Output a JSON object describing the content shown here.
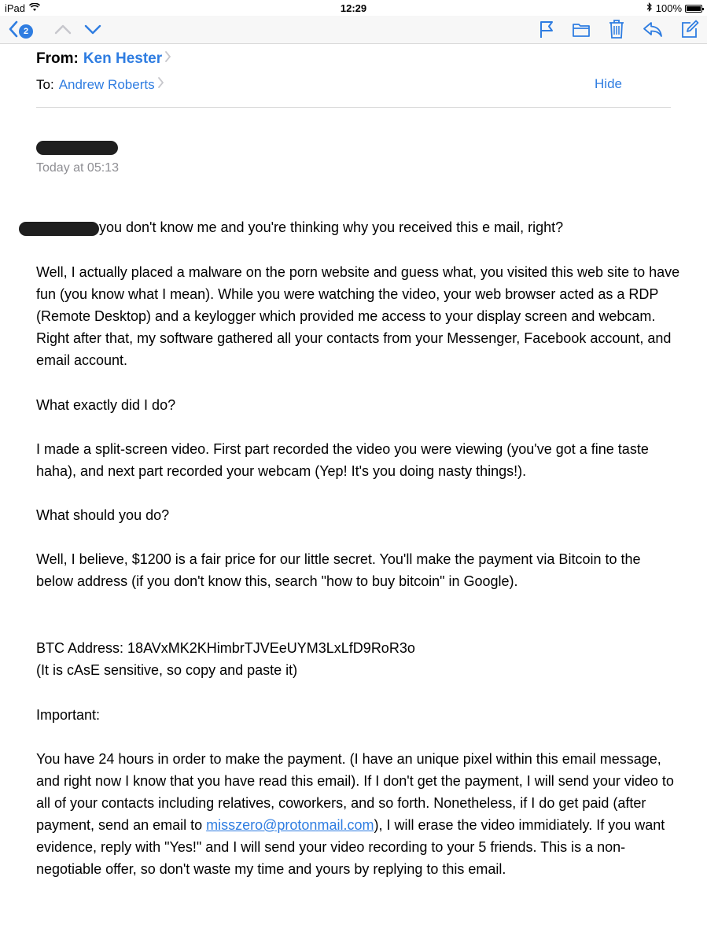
{
  "status_bar": {
    "device": "iPad",
    "time": "12:29",
    "battery": "100%"
  },
  "toolbar": {
    "back_count": "2"
  },
  "header": {
    "from_label": "From:",
    "from_name": "Ken Hester",
    "to_label": "To:",
    "to_name": "Andrew Roberts",
    "hide_label": "Hide",
    "date": "Today at 05:13"
  },
  "body": {
    "greeting": "you don't know me and you're thinking why you received this e mail, right?",
    "p1": "Well, I actually placed a malware on the porn website and guess what, you visited this web site to have fun (you know what I mean). While you were watching the video, your web browser acted as a RDP (Remote Desktop) and a keylogger which provided me access to your display screen and webcam. Right after that, my software gathered all your contacts from your Messenger, Facebook account, and email account.",
    "q1": "What exactly did I do?",
    "p2": "I made a split-screen video. First part recorded the video you were viewing (you've got a fine taste haha), and next part recorded your webcam (Yep! It's you doing nasty things!).",
    "q2": "What should you do?",
    "p3": "Well, I believe, $1200 is a fair price for our little secret. You'll make the payment via Bitcoin to the below address (if you don't know this, search \"how to buy bitcoin\" in Google).",
    "btc_line": "BTC Address: 18AVxMK2KHimbrTJVEeUYM3LxLfD9RoR3o",
    "btc_note": "(It is cAsE sensitive, so copy and paste it)",
    "important": "Important:",
    "p4_before": "You have 24 hours in order to make the payment. (I have an unique pixel within this email message, and right now I know that you have read this email). If I don't get the payment, I will send your video to all of your contacts including relatives, coworkers, and so forth. Nonetheless, if I do get paid (after payment, send an email to ",
    "p4_email": "misszero@protonmail.com",
    "p4_after": "), I will erase the video immidiately. If you want evidence, reply with \"Yes!\" and I will send your video recording to your 5 friends. This is a non-negotiable offer, so don't waste my time and yours by replying to this email."
  },
  "colors": {
    "accent": "#2f7de1",
    "secondary_text": "#8e8e93",
    "redaction": "#1f1f1f"
  }
}
